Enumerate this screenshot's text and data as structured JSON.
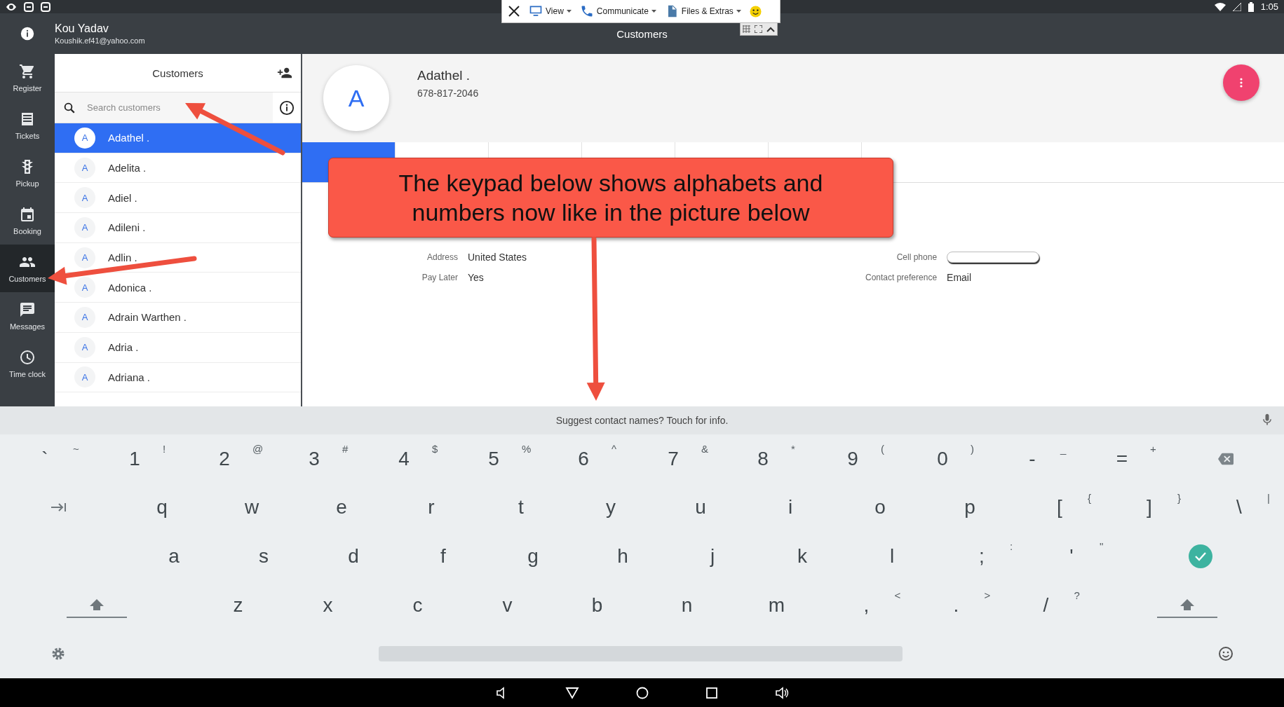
{
  "status_bar": {
    "time": "1:05"
  },
  "remote_toolbar": {
    "menus": [
      {
        "label": "View",
        "kind": "monitor"
      },
      {
        "label": "Communicate",
        "kind": "phone"
      },
      {
        "label": "Files & Extras",
        "kind": "file"
      }
    ]
  },
  "app_bar": {
    "user_name": "Kou Yadav",
    "user_email": "Koushik.ef41@yahoo.com",
    "title": "Customers"
  },
  "nav_rail": [
    {
      "label": "Register",
      "kind": "cart",
      "selected": false
    },
    {
      "label": "Tickets",
      "kind": "list",
      "selected": false
    },
    {
      "label": "Pickup",
      "kind": "traffic",
      "selected": false
    },
    {
      "label": "Booking",
      "kind": "calendar",
      "selected": false
    },
    {
      "label": "Customers",
      "kind": "people",
      "selected": true
    },
    {
      "label": "Messages",
      "kind": "message",
      "selected": false
    },
    {
      "label": "Time clock",
      "kind": "clock",
      "selected": false
    }
  ],
  "customer_list": {
    "title": "Customers",
    "search": {
      "placeholder": "Search customers"
    },
    "items": [
      {
        "initial": "A",
        "name": "Adathel .",
        "selected": true
      },
      {
        "initial": "A",
        "name": "Adelita .",
        "selected": false
      },
      {
        "initial": "A",
        "name": "Adiel .",
        "selected": false
      },
      {
        "initial": "A",
        "name": "Adileni .",
        "selected": false
      },
      {
        "initial": "A",
        "name": "Adlin .",
        "selected": false
      },
      {
        "initial": "A",
        "name": "Adonica .",
        "selected": false
      },
      {
        "initial": "A",
        "name": "Adrain Warthen .",
        "selected": false
      },
      {
        "initial": "A",
        "name": "Adria .",
        "selected": false
      },
      {
        "initial": "A",
        "name": "Adriana .",
        "selected": false
      }
    ]
  },
  "customer_detail": {
    "initial": "A",
    "name": "Adathel .",
    "phone": "678-817-2046",
    "tabs": [
      {
        "selected": true
      },
      {
        "selected": false
      },
      {
        "selected": false
      },
      {
        "selected": false
      },
      {
        "selected": false
      },
      {
        "selected": false
      }
    ],
    "fields_left": [
      {
        "label": "Address",
        "value": "United States",
        "kind": "text"
      },
      {
        "label": "Pay Later",
        "value": "Yes",
        "kind": "text"
      }
    ],
    "fields_right": [
      {
        "label": "Cell phone",
        "kind": "input"
      },
      {
        "label": "Contact preference",
        "value": "Email",
        "kind": "text"
      }
    ]
  },
  "keyboard": {
    "suggestion": "Suggest contact names? Touch for info.",
    "rows": [
      {
        "kind": "number",
        "keys": [
          {
            "kind": "char",
            "main": "`",
            "alt": "~"
          },
          {
            "kind": "char",
            "main": "1",
            "alt": "!"
          },
          {
            "kind": "char",
            "main": "2",
            "alt": "@"
          },
          {
            "kind": "char",
            "main": "3",
            "alt": "#"
          },
          {
            "kind": "char",
            "main": "4",
            "alt": "$"
          },
          {
            "kind": "char",
            "main": "5",
            "alt": "%"
          },
          {
            "kind": "char",
            "main": "6",
            "alt": "^"
          },
          {
            "kind": "char",
            "main": "7",
            "alt": "&"
          },
          {
            "kind": "char",
            "main": "8",
            "alt": "*"
          },
          {
            "kind": "char",
            "main": "9",
            "alt": "("
          },
          {
            "kind": "char",
            "main": "0",
            "alt": ")"
          },
          {
            "kind": "char",
            "main": "-",
            "alt": "_"
          },
          {
            "kind": "char",
            "main": "=",
            "alt": "+"
          },
          {
            "kind": "backspace"
          }
        ]
      },
      {
        "kind": "top",
        "keys": [
          {
            "kind": "tab"
          },
          {
            "kind": "char",
            "main": "q"
          },
          {
            "kind": "char",
            "main": "w"
          },
          {
            "kind": "char",
            "main": "e"
          },
          {
            "kind": "char",
            "main": "r"
          },
          {
            "kind": "char",
            "main": "t"
          },
          {
            "kind": "char",
            "main": "y"
          },
          {
            "kind": "char",
            "main": "u"
          },
          {
            "kind": "char",
            "main": "i"
          },
          {
            "kind": "char",
            "main": "o"
          },
          {
            "kind": "char",
            "main": "p"
          },
          {
            "kind": "char",
            "main": "[",
            "alt": "{"
          },
          {
            "kind": "char",
            "main": "]",
            "alt": "}"
          },
          {
            "kind": "char",
            "main": "\\",
            "alt": "|"
          }
        ]
      },
      {
        "kind": "home",
        "keys": [
          {
            "kind": "char",
            "main": "a"
          },
          {
            "kind": "char",
            "main": "s"
          },
          {
            "kind": "char",
            "main": "d"
          },
          {
            "kind": "char",
            "main": "f"
          },
          {
            "kind": "char",
            "main": "g"
          },
          {
            "kind": "char",
            "main": "h"
          },
          {
            "kind": "char",
            "main": "j"
          },
          {
            "kind": "char",
            "main": "k"
          },
          {
            "kind": "char",
            "main": "l"
          },
          {
            "kind": "char",
            "main": ";",
            "alt": ":"
          },
          {
            "kind": "char",
            "main": "'",
            "alt": "\""
          },
          {
            "kind": "done"
          }
        ]
      },
      {
        "kind": "bottom",
        "keys": [
          {
            "kind": "shift"
          },
          {
            "kind": "char",
            "main": "z"
          },
          {
            "kind": "char",
            "main": "x"
          },
          {
            "kind": "char",
            "main": "c"
          },
          {
            "kind": "char",
            "main": "v"
          },
          {
            "kind": "char",
            "main": "b"
          },
          {
            "kind": "char",
            "main": "n"
          },
          {
            "kind": "char",
            "main": "m"
          },
          {
            "kind": "char",
            "main": ",",
            "alt": "<"
          },
          {
            "kind": "char",
            "main": ".",
            "alt": ">"
          },
          {
            "kind": "char",
            "main": "/",
            "alt": "?"
          },
          {
            "kind": "shift"
          }
        ]
      },
      {
        "kind": "function",
        "keys": [
          {
            "kind": "settings"
          },
          {
            "kind": "space"
          },
          {
            "kind": "emoji"
          }
        ]
      }
    ]
  },
  "annotation": {
    "callout": "The keypad below shows alphabets and numbers now like in the picture below"
  }
}
